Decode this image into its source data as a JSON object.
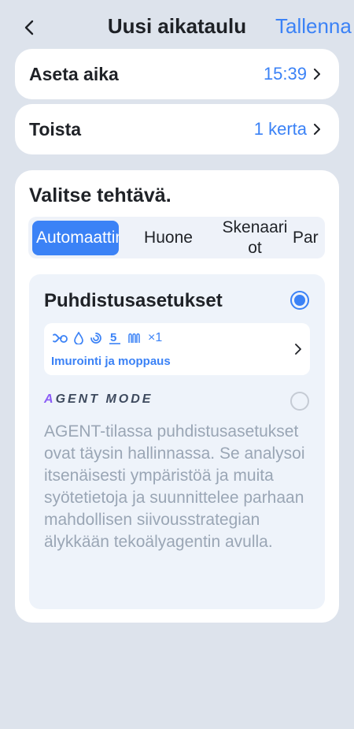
{
  "header": {
    "title": "Uusi aikataulu",
    "save_label": "Tallenna"
  },
  "schedule": {
    "time": {
      "label": "Aseta aika",
      "value": "15:39"
    },
    "repeat": {
      "label": "Toista",
      "value": "1 kerta"
    }
  },
  "task": {
    "title": "Valitse tehtävä.",
    "tabs": [
      {
        "label": "Automaattin…",
        "active": true
      },
      {
        "label": "Huone",
        "active": false
      },
      {
        "label": "Skenaariot",
        "active": false
      },
      {
        "label": "Par",
        "active": false
      }
    ],
    "cleaning_settings": {
      "title": "Puhdistusasetukset",
      "selected": true,
      "icons": [
        "fan-suction-icon",
        "water-drop-icon",
        "swirl-icon",
        "number-5-icon",
        "mop-icon"
      ],
      "times_label": "×1",
      "mode_label": "Imurointi ja moppaus"
    },
    "agent_mode": {
      "label": "AGENT MODE",
      "label_first_letter": "A",
      "label_rest": "GENT MODE",
      "selected": false,
      "description": "AGENT-tilassa puhdistusasetukset ovat täysin hallinnassa. Se analysoi itsenäisesti ympäristöä ja muita syötetietoja ja suunnittelee parhaan mahdollisen siivousstrategian älykkään tekoälyagentin avulla."
    }
  },
  "colors": {
    "accent": "#3b82f6",
    "background": "#dde3ec",
    "agent_gradient": "#8b5cf6"
  }
}
